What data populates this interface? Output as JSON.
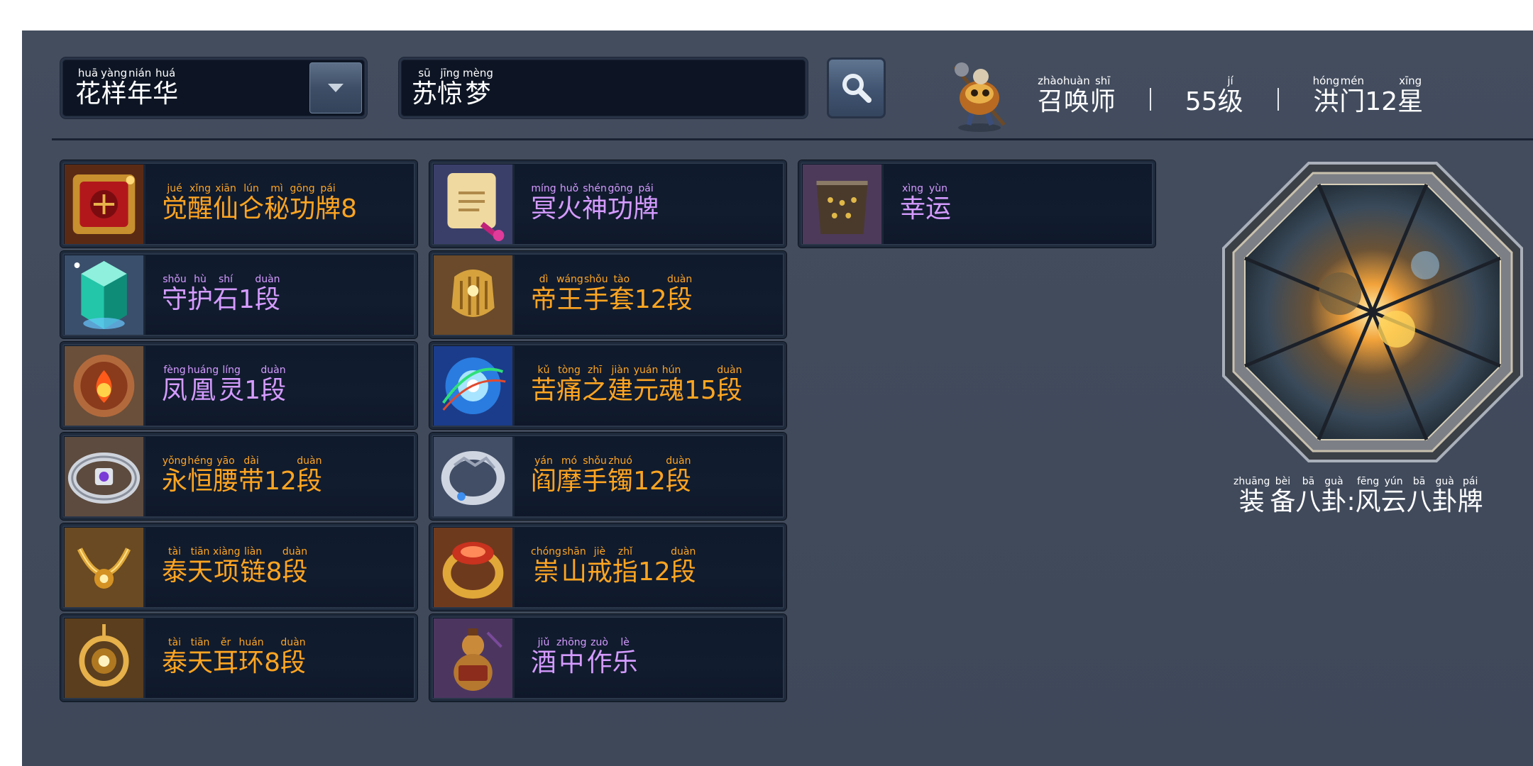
{
  "header": {
    "server": {
      "segments": [
        {
          "t": "花",
          "p": "huā"
        },
        {
          "t": "样",
          "p": "yàng"
        },
        {
          "t": "年",
          "p": "nián"
        },
        {
          "t": "华",
          "p": "huá"
        }
      ]
    },
    "dropdown_icon": "chevron-down-icon",
    "player_name": {
      "segments": [
        {
          "t": "苏",
          "p": "sū"
        },
        {
          "t": "惊",
          "p": "jīng"
        },
        {
          "t": "梦",
          "p": "mèng"
        }
      ]
    },
    "search_icon": "search-icon",
    "class": {
      "segments": [
        {
          "t": "召",
          "p": "zhào"
        },
        {
          "t": "唤",
          "p": "huàn"
        },
        {
          "t": "师",
          "p": "shī"
        }
      ]
    },
    "level": {
      "segments": [
        {
          "t": "55",
          "p": ""
        },
        {
          "t": "级",
          "p": "jí"
        }
      ]
    },
    "guild": {
      "segments": [
        {
          "t": "洪",
          "p": "hóng"
        },
        {
          "t": "门",
          "p": "mén"
        },
        {
          "t": "12",
          "p": ""
        },
        {
          "t": "星",
          "p": "xīng"
        }
      ]
    }
  },
  "equipment": {
    "col1": [
      {
        "icon": "red-seal-plaque-icon",
        "color": "#ffa521",
        "segments": [
          {
            "t": "觉",
            "p": "jué"
          },
          {
            "t": "醒",
            "p": "xǐng"
          },
          {
            "t": "仙",
            "p": "xiān"
          },
          {
            "t": "仑",
            "p": "lún"
          },
          {
            "t": "秘",
            "p": "mì"
          },
          {
            "t": "功",
            "p": "gōng"
          },
          {
            "t": "牌",
            "p": "pái"
          },
          {
            "t": "8",
            "p": ""
          }
        ]
      },
      {
        "icon": "green-crystal-icon",
        "color": "#d59bff",
        "segments": [
          {
            "t": "守",
            "p": "shǒu"
          },
          {
            "t": "护",
            "p": "hù"
          },
          {
            "t": "石",
            "p": "shí"
          },
          {
            "t": "1",
            "p": ""
          },
          {
            "t": "段",
            "p": "duàn"
          }
        ]
      },
      {
        "icon": "phoenix-orb-icon",
        "color": "#d59bff",
        "segments": [
          {
            "t": "凤",
            "p": "fèng"
          },
          {
            "t": "凰",
            "p": "huáng"
          },
          {
            "t": "灵",
            "p": "líng"
          },
          {
            "t": "1",
            "p": ""
          },
          {
            "t": "段",
            "p": "duàn"
          }
        ]
      },
      {
        "icon": "silver-belt-icon",
        "color": "#ffa521",
        "segments": [
          {
            "t": "永",
            "p": "yǒng"
          },
          {
            "t": "恒",
            "p": "héng"
          },
          {
            "t": "腰",
            "p": "yāo"
          },
          {
            "t": "带",
            "p": "dài"
          },
          {
            "t": "12",
            "p": ""
          },
          {
            "t": "段",
            "p": "duàn"
          }
        ]
      },
      {
        "icon": "gold-necklace-icon",
        "color": "#ffa521",
        "segments": [
          {
            "t": "泰",
            "p": "tài"
          },
          {
            "t": "天",
            "p": "tiān"
          },
          {
            "t": "项",
            "p": "xiàng"
          },
          {
            "t": "链",
            "p": "liàn"
          },
          {
            "t": "8",
            "p": ""
          },
          {
            "t": "段",
            "p": "duàn"
          }
        ]
      },
      {
        "icon": "gold-earring-icon",
        "color": "#ffa521",
        "segments": [
          {
            "t": "泰",
            "p": "tài"
          },
          {
            "t": "天",
            "p": "tiān"
          },
          {
            "t": "耳",
            "p": "ěr"
          },
          {
            "t": "环",
            "p": "huán"
          },
          {
            "t": "8",
            "p": ""
          },
          {
            "t": "段",
            "p": "duàn"
          }
        ]
      }
    ],
    "col2": [
      {
        "icon": "scroll-plaque-icon",
        "color": "#d59bff",
        "segments": [
          {
            "t": "冥",
            "p": "míng"
          },
          {
            "t": "火",
            "p": "huǒ"
          },
          {
            "t": "神",
            "p": "shén"
          },
          {
            "t": "功",
            "p": "gōng"
          },
          {
            "t": "牌",
            "p": "pái"
          }
        ]
      },
      {
        "icon": "gold-gauntlet-icon",
        "color": "#ffa521",
        "segments": [
          {
            "t": "帝",
            "p": "dì"
          },
          {
            "t": "王",
            "p": "wáng"
          },
          {
            "t": "手",
            "p": "shǒu"
          },
          {
            "t": "套",
            "p": "tào"
          },
          {
            "t": "12",
            "p": ""
          },
          {
            "t": "段",
            "p": "duàn"
          }
        ]
      },
      {
        "icon": "blue-energy-orb-icon",
        "color": "#ffa521",
        "segments": [
          {
            "t": "苦",
            "p": "kǔ"
          },
          {
            "t": "痛",
            "p": "tòng"
          },
          {
            "t": "之",
            "p": "zhī"
          },
          {
            "t": "建",
            "p": "jiàn"
          },
          {
            "t": "元",
            "p": "yuán"
          },
          {
            "t": "魂",
            "p": "hún"
          },
          {
            "t": "15",
            "p": ""
          },
          {
            "t": "段",
            "p": "duàn"
          }
        ]
      },
      {
        "icon": "silver-bracelet-icon",
        "color": "#ffa521",
        "segments": [
          {
            "t": "阎",
            "p": "yán"
          },
          {
            "t": "摩",
            "p": "mó"
          },
          {
            "t": "手",
            "p": "shǒu"
          },
          {
            "t": "镯",
            "p": "zhuó"
          },
          {
            "t": "12",
            "p": ""
          },
          {
            "t": "段",
            "p": "duàn"
          }
        ]
      },
      {
        "icon": "gold-ring-icon",
        "color": "#ffa521",
        "segments": [
          {
            "t": "崇",
            "p": "chóng"
          },
          {
            "t": "山",
            "p": "shān"
          },
          {
            "t": "戒",
            "p": "jiè"
          },
          {
            "t": "指",
            "p": "zhǐ"
          },
          {
            "t": "12",
            "p": ""
          },
          {
            "t": "段",
            "p": "duàn"
          }
        ]
      },
      {
        "icon": "wine-gourd-icon",
        "color": "#d59bff",
        "segments": [
          {
            "t": "酒",
            "p": "jiǔ"
          },
          {
            "t": "中",
            "p": "zhōng"
          },
          {
            "t": "作",
            "p": "zuò"
          },
          {
            "t": "乐",
            "p": "lè"
          }
        ]
      }
    ],
    "col3": [
      {
        "icon": "leather-bag-icon",
        "color": "#d59bff",
        "segments": [
          {
            "t": "幸",
            "p": "xìng"
          },
          {
            "t": "运",
            "p": "yùn"
          }
        ]
      }
    ]
  },
  "bagua": {
    "icon": "bagua-octagon-icon",
    "caption": {
      "segments": [
        {
          "t": "装",
          "p": "zhuāng"
        },
        {
          "t": "备",
          "p": "bèi"
        },
        {
          "t": "八",
          "p": "bā"
        },
        {
          "t": "卦",
          "p": "guà"
        },
        {
          "t": ":",
          "p": ""
        },
        {
          "t": "风",
          "p": "fēng"
        },
        {
          "t": "云",
          "p": "yún"
        },
        {
          "t": "八",
          "p": "bā"
        },
        {
          "t": "卦",
          "p": "guà"
        },
        {
          "t": "牌",
          "p": "pái"
        }
      ]
    }
  }
}
